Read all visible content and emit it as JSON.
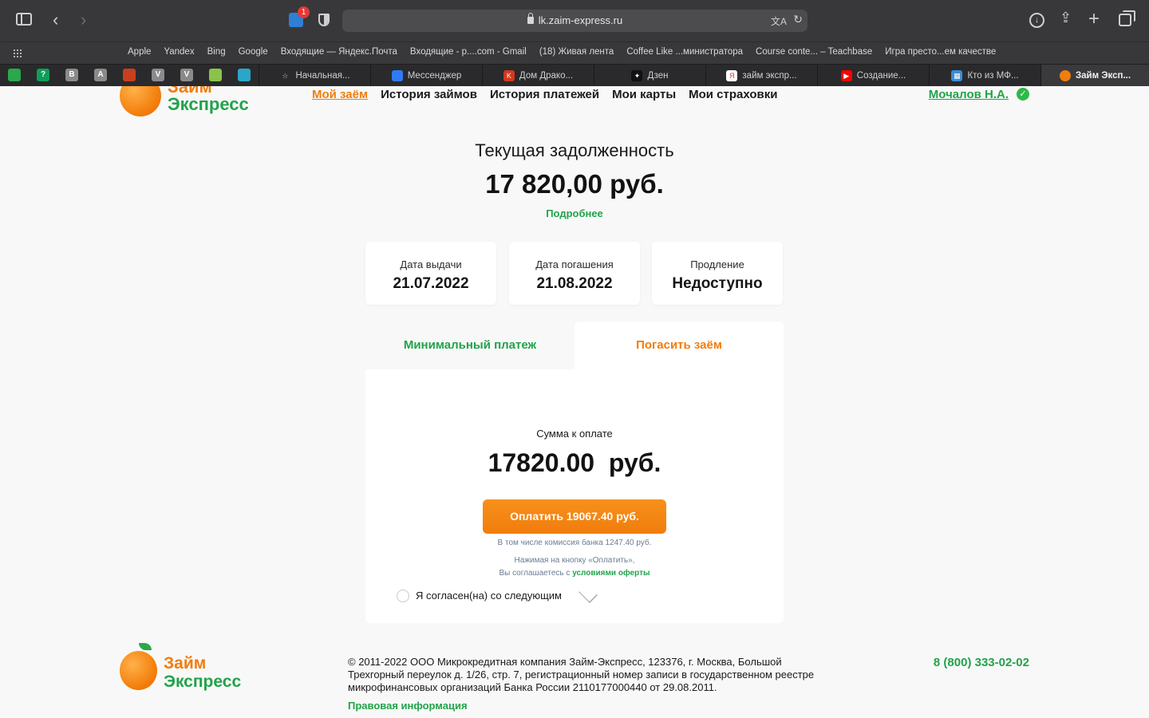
{
  "browser": {
    "url": "lk.zaim-express.ru",
    "extension_badge": "1",
    "favorites": [
      "Apple",
      "Yandex",
      "Bing",
      "Google",
      "Входящие — Яндекс.Почта",
      "Входящие - p....com - Gmail",
      "(18) Живая лента",
      "Coffee Like ...министратора",
      "Course conte... – Teachbase",
      "Игра престо...ем качестве"
    ],
    "pinned_tabs": [
      {
        "glyph": "",
        "color": "#2aa84b"
      },
      {
        "glyph": "?",
        "color": "#0f9d58"
      },
      {
        "glyph": "B",
        "color": "#8a8a8a"
      },
      {
        "glyph": "A",
        "color": "#8a8a8a"
      },
      {
        "glyph": "",
        "color": "#c73f1e"
      },
      {
        "glyph": "V",
        "color": "#8a8a8a"
      },
      {
        "glyph": "V",
        "color": "#8a8a8a"
      },
      {
        "glyph": "",
        "color": "#8bc34a"
      },
      {
        "glyph": "",
        "color": "#2aa6c9"
      }
    ],
    "tabs": [
      {
        "label": "Начальная...",
        "fav_color": "transparent",
        "fav_glyph": "☆"
      },
      {
        "label": "Мессенджер",
        "fav_color": "#2f7bf5",
        "fav_glyph": ""
      },
      {
        "label": "Дом Драко...",
        "fav_color": "#d2381e",
        "fav_glyph": "K"
      },
      {
        "label": "Дзен",
        "fav_color": "#111111",
        "fav_glyph": "✦"
      },
      {
        "label": "займ экспр...",
        "fav_color": "#ffffff",
        "fav_glyph": "Я"
      },
      {
        "label": "Создание...",
        "fav_color": "#ff0000",
        "fav_glyph": "▶"
      },
      {
        "label": "Кто из МФ...",
        "fav_color": "#3a8dd6",
        "fav_glyph": "▦"
      },
      {
        "label": "Займ Эксп...",
        "fav_color": "#f07d0d",
        "fav_glyph": "",
        "active": true
      }
    ]
  },
  "site": {
    "logo_top": "Займ",
    "logo_bottom": "Экспресс",
    "nav": [
      "Мой заём",
      "История займов",
      "История платежей",
      "Мои карты",
      "Мои страховки"
    ],
    "user_name": "Мочалов Н.А."
  },
  "debt": {
    "title": "Текущая задолженность",
    "amount": "17 820,00 руб.",
    "details_link": "Подробнее"
  },
  "cards": [
    {
      "label": "Дата выдачи",
      "value": "21.07.2022"
    },
    {
      "label": "Дата погашения",
      "value": "21.08.2022"
    },
    {
      "label": "Продление",
      "value": "Недоступно"
    }
  ],
  "payment": {
    "tab_min": "Минимальный платеж",
    "tab_full": "Погасить заём",
    "sum_label": "Сумма к оплате",
    "sum_value": "17820.00  руб.",
    "button": "Оплатить 19067.40 руб.",
    "fee_note": "В том числе комиссия банка 1247.40 руб.",
    "offer_line1": "Нажимая на кнопку «Оплатить»,",
    "offer_line2_prefix": "Вы соглашаетесь с ",
    "offer_link": "условиями оферты",
    "agree_label": "Я согласен(на) со следующим"
  },
  "footer": {
    "logo_top": "Займ",
    "logo_bottom": "Экспресс",
    "legal": "© 2011-2022 ООО Микрокредитная компания Займ-Экспресс, 123376, г. Москва, Большой Трехгорный переулок д. 1/26, стр. 7, регистрационный номер записи в государственном реестре микрофинансовых организаций Банка России 2110177000440 от 29.08.2011.",
    "legal_link": "Правовая информация",
    "phone": "8 (800) 333-02-02"
  },
  "colors": {
    "accent_orange": "#f07d0d",
    "accent_green": "#22a34a"
  }
}
